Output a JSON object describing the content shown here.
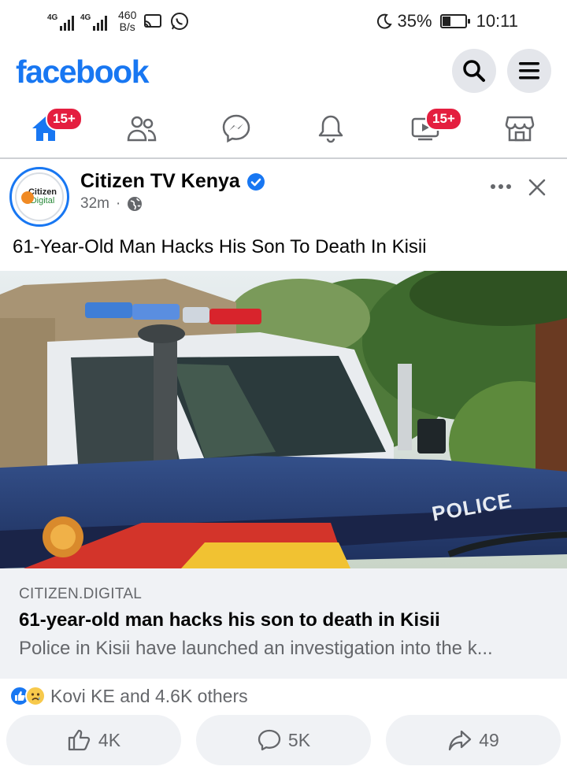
{
  "status_bar": {
    "network_1": "4G",
    "network_2": "4G",
    "speed_value": "460",
    "speed_unit": "B/s",
    "battery": "35%",
    "battery_level": 0.35,
    "time": "10:11"
  },
  "header": {
    "logo": "facebook",
    "brand_color": "#1877f2"
  },
  "nav": {
    "home_badge": "15+",
    "video_badge": "15+",
    "icons": [
      "home-icon",
      "friends-icon",
      "messenger-icon",
      "notifications-icon",
      "video-icon",
      "marketplace-icon"
    ]
  },
  "post": {
    "page_name": "Citizen TV Kenya",
    "avatar_line1": "Citizen",
    "avatar_line2": "Digital",
    "time_ago": "32m",
    "separator": "·",
    "text": "61-Year-Old Man Hacks His Son To Death In Kisii",
    "image_door_text": "POLICE"
  },
  "link_preview": {
    "domain": "CITIZEN.DIGITAL",
    "title": "61-year-old man hacks his son to death in Kisii",
    "description": "Police in Kisii have launched an investigation into the k..."
  },
  "reactions": {
    "summary": "Kovi KE and 4.6K others"
  },
  "actions": {
    "like_count": "4K",
    "comment_count": "5K",
    "share_count": "49"
  }
}
